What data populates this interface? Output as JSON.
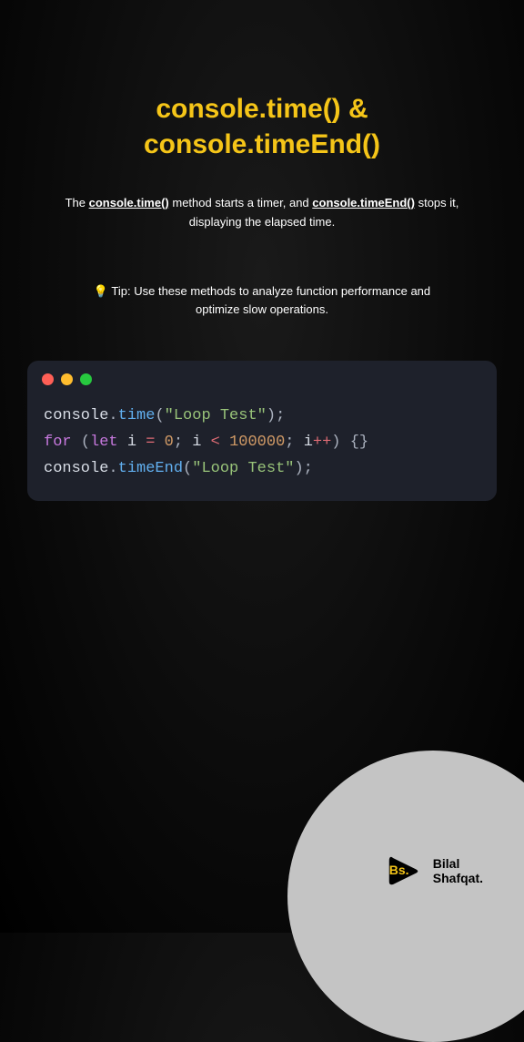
{
  "title": "console.time() & console.timeEnd()",
  "description": {
    "prefix": "The ",
    "highlight1": "console.time()",
    "mid1": " method starts a timer, and ",
    "highlight2": "console.timeEnd()",
    "suffix": " stops it, displaying the elapsed time."
  },
  "tip": "💡 Tip: Use these methods to analyze function performance and optimize slow operations.",
  "code": {
    "line1": {
      "console": "console",
      "dot1": ".",
      "method": "time",
      "paren1": "(",
      "string": "\"Loop Test\"",
      "paren2": ")",
      "semi": ";"
    },
    "line2": {
      "for": "for",
      "space1": " ",
      "paren1": "(",
      "let": "let",
      "space2": " ",
      "var": "i",
      "space3": " ",
      "eq": "=",
      "space4": " ",
      "zero": "0",
      "semi1": ";",
      "space5": " ",
      "var2": "i",
      "space6": " ",
      "lt": "<",
      "space7": " ",
      "num": "100000",
      "semi2": ";",
      "space8": " ",
      "var3": "i",
      "inc": "++",
      "paren2": ")",
      "space9": " ",
      "braces": "{}"
    },
    "line3": {
      "console": "console",
      "dot1": ".",
      "method": "timeEnd",
      "paren1": "(",
      "string": "\"Loop Test\"",
      "paren2": ")",
      "semi": ";"
    }
  },
  "footer": {
    "logo_text": "Bs.",
    "brand_line1": "Bilal",
    "brand_line2": "Shafqat."
  }
}
